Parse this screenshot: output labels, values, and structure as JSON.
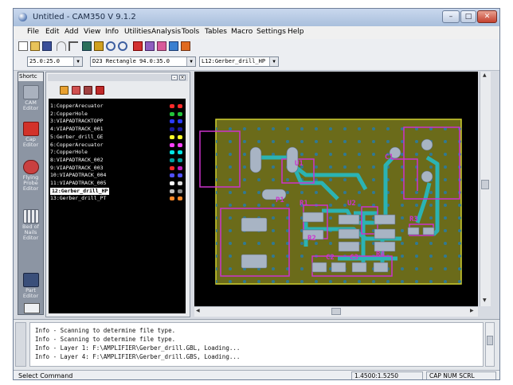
{
  "window": {
    "title": "Untitled - CAM350 V 9.1.2",
    "controls": {
      "minimize": "–",
      "maximize": "□",
      "close": "✕"
    }
  },
  "menu": [
    "File",
    "Edit",
    "Add",
    "View",
    "Info",
    "Utilities",
    "Analysis",
    "Tools",
    "Tables",
    "Macro",
    "Settings",
    "Help"
  ],
  "toolbar2": {
    "grid_value": "25.0:25.0",
    "dcode_value": "D23  Rectangle 94.0:35.0",
    "layer_value": "L12:Gerber_drill_HP"
  },
  "shortcuts": {
    "header": "Shortc",
    "tools": [
      "CAM Editor",
      "Cap Editor",
      "Flying Probe Editor",
      "Bed of Nails Editor",
      "Part Editor"
    ]
  },
  "layers": [
    {
      "label": "1:CopperArecuator",
      "c1": "#ff2a2a",
      "c2": "#ff2a2a"
    },
    {
      "label": "2:CopperHole",
      "c1": "#22c23a",
      "c2": "#22c23a"
    },
    {
      "label": "3:VIAPADTRACKTOPP",
      "c1": "#2a3aff",
      "c2": "#2a3aff"
    },
    {
      "label": "4:VIAPADTRACK_001",
      "c1": "#1a1aa0",
      "c2": "#1a1aa0"
    },
    {
      "label": "5:Gerber_drill_GE",
      "c1": "#ffff2a",
      "c2": "#ffff2a"
    },
    {
      "label": "6:CopperArecuator",
      "c1": "#ff40ff",
      "c2": "#ff40ff"
    },
    {
      "label": "7:CopperHole",
      "c1": "#00e5e5",
      "c2": "#00e5e5"
    },
    {
      "label": "8:VIAPADTRACK_002",
      "c1": "#00a0a0",
      "c2": "#00a0a0"
    },
    {
      "label": "9:VIAPADTRACK_003",
      "c1": "#ff2a2a",
      "c2": "#c020c0"
    },
    {
      "label": "10:VIAPADTRACK_004",
      "c1": "#5050ff",
      "c2": "#5050ff"
    },
    {
      "label": "11:VIAPADTRACK_005",
      "c1": "#ffffff",
      "c2": "#dddddd"
    },
    {
      "label": "12:Gerber_drill_HP",
      "c1": "#c0c0c0",
      "c2": "#8a8a8a",
      "selected": true
    },
    {
      "label": "13:Gerber_drill_PT",
      "c1": "#ff8a2a",
      "c2": "#ff8a2a"
    }
  ],
  "pcb": {
    "designators": [
      "U1",
      "R1",
      "P1",
      "C1",
      "R2",
      "U2",
      "R3",
      "C2",
      "C3",
      "R4"
    ]
  },
  "output": {
    "lines": [
      "Info - Scanning to determine file type.",
      "Info - Scanning to determine file type.",
      "Info - Layer 1: F:\\AMPLIFIER\\Gerber_drill.GBL, Loading...",
      "Info - Layer 4: F:\\AMPLIFIER\\Gerber_drill.GBS, Loading..."
    ]
  },
  "status": {
    "command": "Select Command",
    "coords": "1.4500:1.5250",
    "flags": "CAP NUM SCRL"
  },
  "colors": {
    "board": "#6b6b1a",
    "trace": "#2bb3b3",
    "silkscreen": "#cc33cc",
    "pad": "#a8b4c4",
    "canvas": "#000000"
  }
}
